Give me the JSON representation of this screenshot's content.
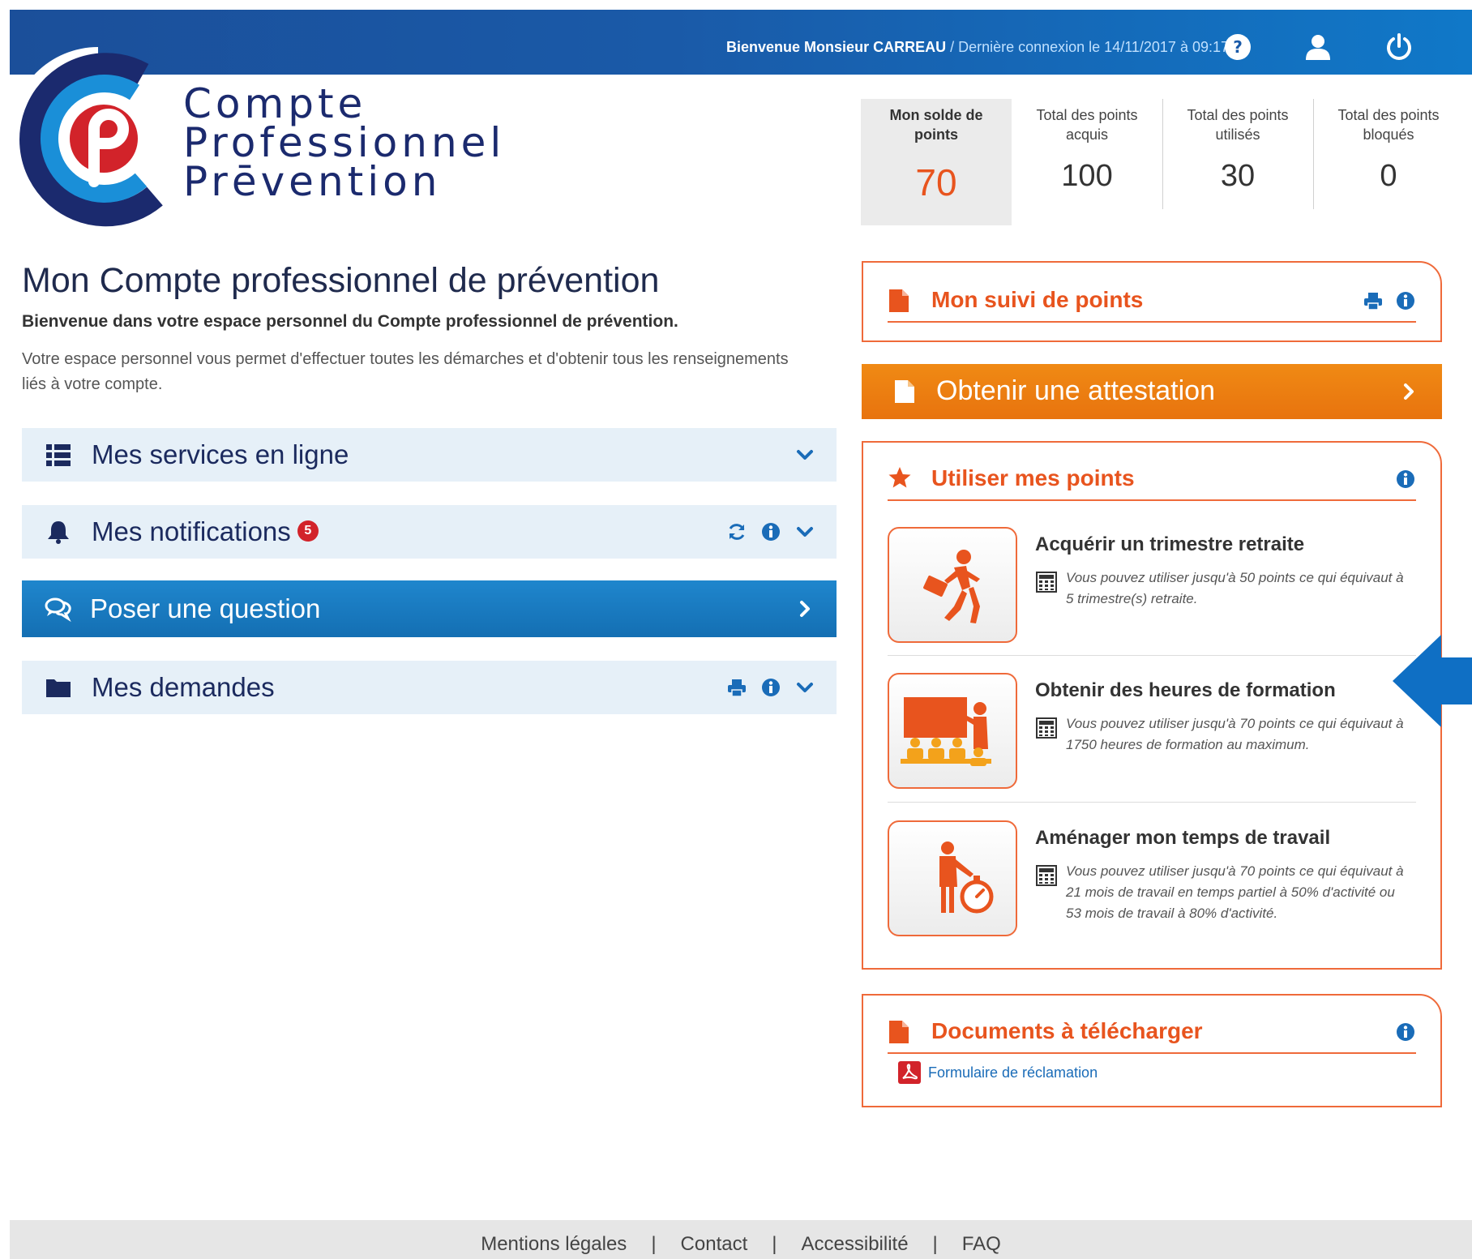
{
  "topbar": {
    "welcome": "Bienvenue Monsieur CARREAU",
    "last_login": " / Dernière connexion le 14/11/2017 à 09:17",
    "icons": [
      "help-icon",
      "user-icon",
      "power-icon"
    ]
  },
  "logo": {
    "line1": "Compte",
    "line2": "Professionnel",
    "line3": "Prēvention"
  },
  "stats": [
    {
      "label": "Mon solde de points",
      "value": "70"
    },
    {
      "label": "Total des points acquis",
      "value": "100"
    },
    {
      "label": "Total des points utilisés",
      "value": "30"
    },
    {
      "label": "Total des points bloqués",
      "value": "0"
    }
  ],
  "main": {
    "title": "Mon Compte professionnel de prévention",
    "lead": "Bienvenue dans votre espace personnel du Compte professionnel de prévention.",
    "description": "Votre espace personnel vous permet d'effectuer toutes les démarches et d'obtenir tous les renseignements liés à votre compte."
  },
  "accordions": {
    "services": "Mes services en ligne",
    "notifications": "Mes notifications",
    "notifications_count": "5",
    "question": "Poser une question",
    "demandes": "Mes demandes"
  },
  "suivi": {
    "title": "Mon suivi de points"
  },
  "attestation": {
    "label": "Obtenir une attestation"
  },
  "utiliser": {
    "title": "Utiliser mes points",
    "items": [
      {
        "title": "Acquérir un trimestre retraite",
        "text": "Vous pouvez utiliser jusqu'à 50 points ce qui équivaut à 5 trimestre(s) retraite."
      },
      {
        "title": "Obtenir des heures de formation",
        "text": "Vous pouvez utiliser jusqu'à 70 points ce qui équivaut à 1750 heures de formation au maximum."
      },
      {
        "title": "Aménager mon temps de travail",
        "text": "Vous pouvez utiliser jusqu'à 70 points ce qui équivaut à 21 mois de travail en temps partiel à 50% d'activité ou 53 mois de travail à 80% d'activité."
      }
    ]
  },
  "documents": {
    "title": "Documents à télécharger",
    "link": "Formulaire de réclamation"
  },
  "footer": {
    "links": [
      "Mentions légales",
      "Contact",
      "Accessibilité",
      "FAQ"
    ]
  },
  "colors": {
    "accent_orange": "#e8541e",
    "panel_border": "#ef6a3a",
    "primary_blue": "#1a5aa8",
    "attest_orange": "#f08a14"
  }
}
